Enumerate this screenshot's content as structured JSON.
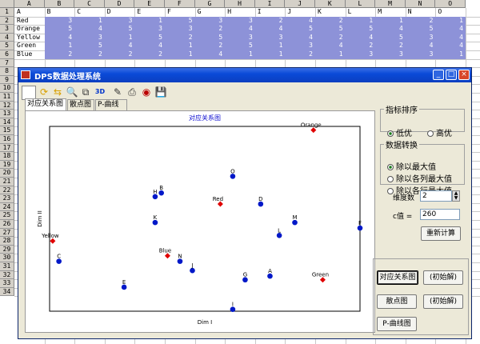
{
  "sheet": {
    "columns": [
      "A",
      "B",
      "C",
      "D",
      "E",
      "F",
      "G",
      "H",
      "I",
      "J",
      "K",
      "L",
      "M",
      "N",
      "O"
    ],
    "subcolumns": [
      "A",
      "B",
      "C",
      "D",
      "E",
      "F",
      "G",
      "H",
      "I",
      "J",
      "K",
      "L",
      "M",
      "N",
      "O"
    ],
    "rows": [
      {
        "num": "1",
        "label": "",
        "values": [
          "",
          "",
          "",
          "",
          "",
          "",
          "",
          "",
          "",
          "",
          "",
          "",
          "",
          "",
          ""
        ]
      },
      {
        "num": "2",
        "label": "Red",
        "values": [
          "3",
          "1",
          "3",
          "1",
          "5",
          "3",
          "3",
          "2",
          "4",
          "2",
          "1",
          "1",
          "2",
          "1"
        ]
      },
      {
        "num": "3",
        "label": "Orange",
        "values": [
          "5",
          "4",
          "5",
          "3",
          "3",
          "2",
          "4",
          "4",
          "5",
          "5",
          "5",
          "4",
          "5",
          "4"
        ]
      },
      {
        "num": "4",
        "label": "Yellow",
        "values": [
          "4",
          "3",
          "1",
          "5",
          "2",
          "5",
          "3",
          "3",
          "4",
          "2",
          "4",
          "5",
          "3",
          "4"
        ]
      },
      {
        "num": "5",
        "label": "Green",
        "values": [
          "1",
          "5",
          "4",
          "4",
          "1",
          "2",
          "5",
          "1",
          "3",
          "4",
          "2",
          "2",
          "4",
          "4"
        ]
      },
      {
        "num": "6",
        "label": "Blue",
        "values": [
          "2",
          "2",
          "2",
          "2",
          "1",
          "4",
          "1",
          "1",
          "2",
          "1",
          "3",
          "3",
          "3",
          "1"
        ]
      },
      {
        "num": "7"
      },
      {
        "num": "8"
      },
      {
        "num": "9"
      },
      {
        "num": "10"
      },
      {
        "num": "11"
      },
      {
        "num": "12"
      },
      {
        "num": "13"
      },
      {
        "num": "14"
      },
      {
        "num": "15"
      },
      {
        "num": "16"
      },
      {
        "num": "17"
      },
      {
        "num": "18"
      },
      {
        "num": "19"
      },
      {
        "num": "20"
      },
      {
        "num": "21"
      },
      {
        "num": "22"
      },
      {
        "num": "23"
      },
      {
        "num": "24"
      },
      {
        "num": "25"
      },
      {
        "num": "26"
      },
      {
        "num": "27"
      },
      {
        "num": "28"
      },
      {
        "num": "29"
      },
      {
        "num": "30"
      },
      {
        "num": "31"
      },
      {
        "num": "32"
      },
      {
        "num": "33"
      },
      {
        "num": "34"
      }
    ]
  },
  "window": {
    "title": "DPS数据处理系统",
    "buttons": {
      "minimize": "_",
      "maximize": "□",
      "close": "×"
    },
    "toolbar": [
      "select-tool",
      "rotate-icon",
      "swap-icon",
      "zoom-icon",
      "copy-icon",
      "3D",
      "draw-icon",
      "print-icon",
      "palette-icon",
      "save-icon"
    ],
    "toolbar_3d_label": "3D",
    "tabs": [
      "对应关系图",
      "散点图",
      "P-曲线"
    ],
    "active_tab": 0
  },
  "panel": {
    "sort": {
      "legend": "指标排序",
      "options": [
        "低优",
        "高优"
      ],
      "selected": 0
    },
    "transform": {
      "legend": "数据转换",
      "options": [
        "除以最大值",
        "除以各列最大值",
        "除以各行最大值"
      ],
      "selected": 0
    },
    "dim_label": "维度数",
    "dim_value": "2",
    "c_label": "c值 =",
    "c_value": "260",
    "recalc_label": "重新计算",
    "btn_corr": "对应关系图",
    "btn_init1": "(初始解)",
    "btn_scatter": "散点图",
    "btn_init2": "(初始解)",
    "btn_pcurve": "P-曲线图"
  },
  "chart_data": {
    "type": "scatter",
    "title": "对应关系图",
    "xlabel": "Dim I",
    "ylabel": "Dim II",
    "xlim": [
      0,
      100
    ],
    "ylim": [
      0,
      100
    ],
    "grid": false,
    "series": [
      {
        "name": "Red diamonds",
        "color": "#e00000",
        "marker": "diamond",
        "points": [
          {
            "label": "Orange",
            "x": 85,
            "y": 98
          },
          {
            "label": "Red",
            "x": 55,
            "y": 58
          },
          {
            "label": "Yellow",
            "x": 1,
            "y": 38
          },
          {
            "label": "Blue",
            "x": 38,
            "y": 30
          },
          {
            "label": "Green",
            "x": 88,
            "y": 17
          }
        ]
      },
      {
        "name": "Blue circles",
        "color": "#0018c8",
        "marker": "circle",
        "points": [
          {
            "label": "O",
            "x": 59,
            "y": 73
          },
          {
            "label": "H",
            "x": 34,
            "y": 62
          },
          {
            "label": "B",
            "x": 36,
            "y": 64
          },
          {
            "label": "D",
            "x": 68,
            "y": 58
          },
          {
            "label": "K",
            "x": 34,
            "y": 48
          },
          {
            "label": "M",
            "x": 79,
            "y": 48
          },
          {
            "label": "L",
            "x": 74,
            "y": 41
          },
          {
            "label": "F",
            "x": 100,
            "y": 45
          },
          {
            "label": "C",
            "x": 3,
            "y": 27
          },
          {
            "label": "N",
            "x": 42,
            "y": 27
          },
          {
            "label": "J",
            "x": 46,
            "y": 22
          },
          {
            "label": "A",
            "x": 71,
            "y": 19
          },
          {
            "label": "G",
            "x": 63,
            "y": 17
          },
          {
            "label": "E",
            "x": 24,
            "y": 13
          },
          {
            "label": "I",
            "x": 59,
            "y": 1
          }
        ]
      }
    ]
  }
}
